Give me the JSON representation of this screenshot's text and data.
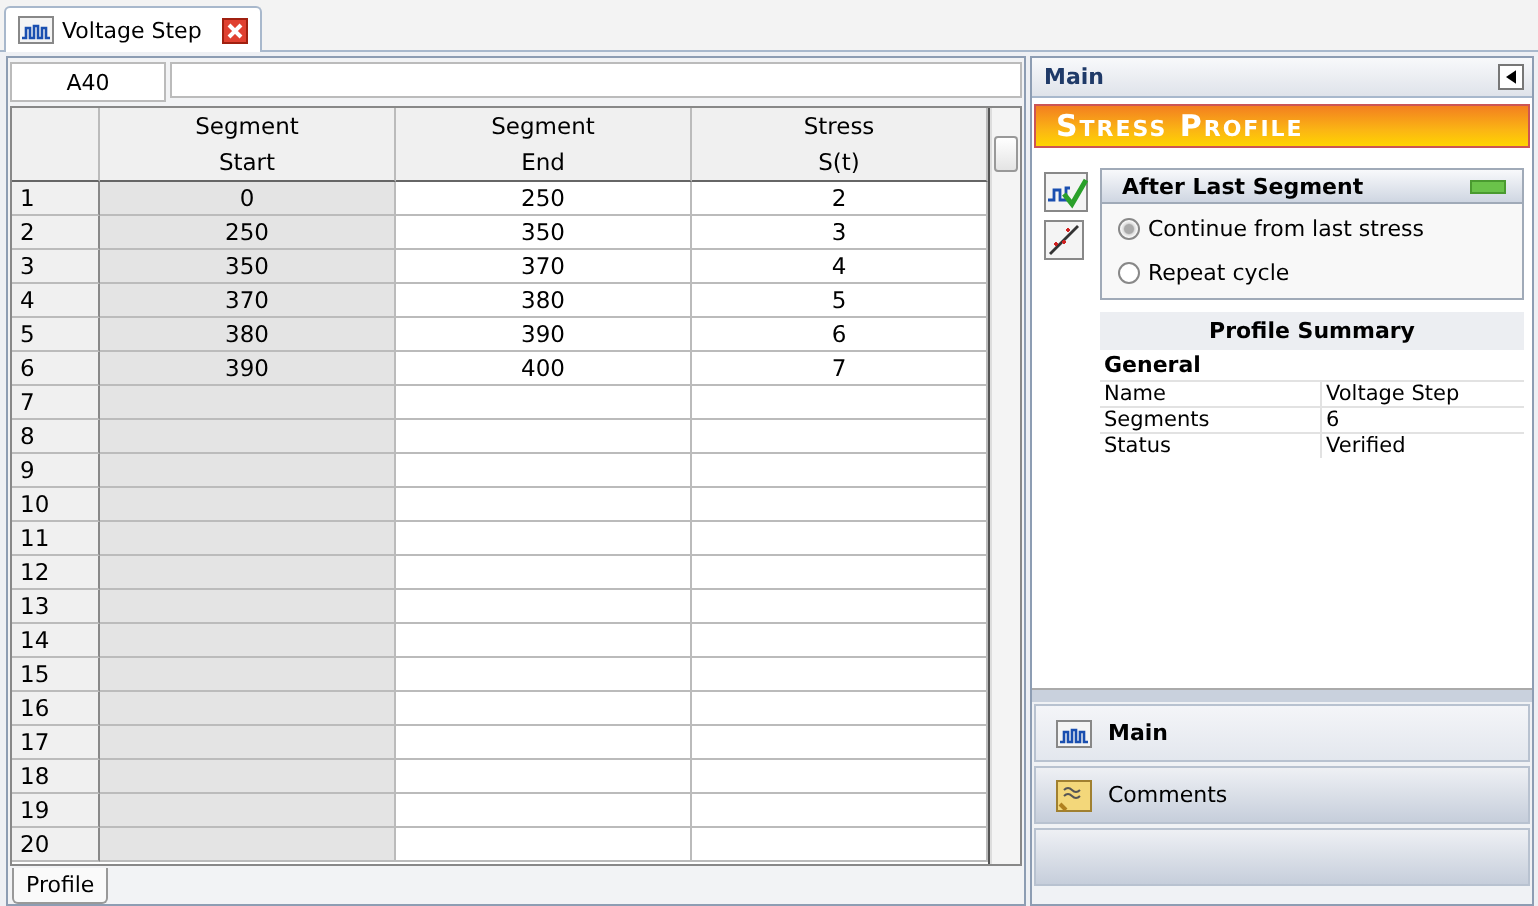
{
  "document_tab": {
    "label": "Voltage Step"
  },
  "cell_reference": "A40",
  "table": {
    "columns": [
      "Segment\nStart",
      "Segment\nEnd",
      "Stress\nS(t)"
    ],
    "rows": [
      {
        "number": "1",
        "cells": [
          "0",
          "250",
          "2"
        ]
      },
      {
        "number": "2",
        "cells": [
          "250",
          "350",
          "3"
        ]
      },
      {
        "number": "3",
        "cells": [
          "350",
          "370",
          "4"
        ]
      },
      {
        "number": "4",
        "cells": [
          "370",
          "380",
          "5"
        ]
      },
      {
        "number": "5",
        "cells": [
          "380",
          "390",
          "6"
        ]
      },
      {
        "number": "6",
        "cells": [
          "390",
          "400",
          "7"
        ]
      },
      {
        "number": "7",
        "cells": []
      },
      {
        "number": "8",
        "cells": []
      },
      {
        "number": "9",
        "cells": []
      },
      {
        "number": "10",
        "cells": []
      },
      {
        "number": "11",
        "cells": []
      },
      {
        "number": "12",
        "cells": []
      },
      {
        "number": "13",
        "cells": []
      },
      {
        "number": "14",
        "cells": []
      },
      {
        "number": "15",
        "cells": []
      },
      {
        "number": "16",
        "cells": []
      },
      {
        "number": "17",
        "cells": []
      },
      {
        "number": "18",
        "cells": []
      },
      {
        "number": "19",
        "cells": []
      },
      {
        "number": "20",
        "cells": []
      }
    ]
  },
  "sheet_tabs": [
    {
      "label": "Profile",
      "selected": true
    }
  ],
  "side_panel": {
    "title": "Main",
    "banner": "Stress Profile",
    "after_last_segment": {
      "title": "After Last Segment",
      "options": [
        {
          "label": "Continue from last stress",
          "selected": true
        },
        {
          "label": "Repeat cycle",
          "selected": false
        }
      ]
    },
    "summary": {
      "title": "Profile Summary",
      "group": "General",
      "rows": [
        [
          "Name",
          "Voltage Step"
        ],
        [
          "Segments",
          "6"
        ],
        [
          "Status",
          "Verified"
        ]
      ]
    },
    "nav_buttons": [
      {
        "label": "Main",
        "selected": true,
        "kind": "chart"
      },
      {
        "label": "Comments",
        "selected": false,
        "kind": "note"
      }
    ]
  }
}
